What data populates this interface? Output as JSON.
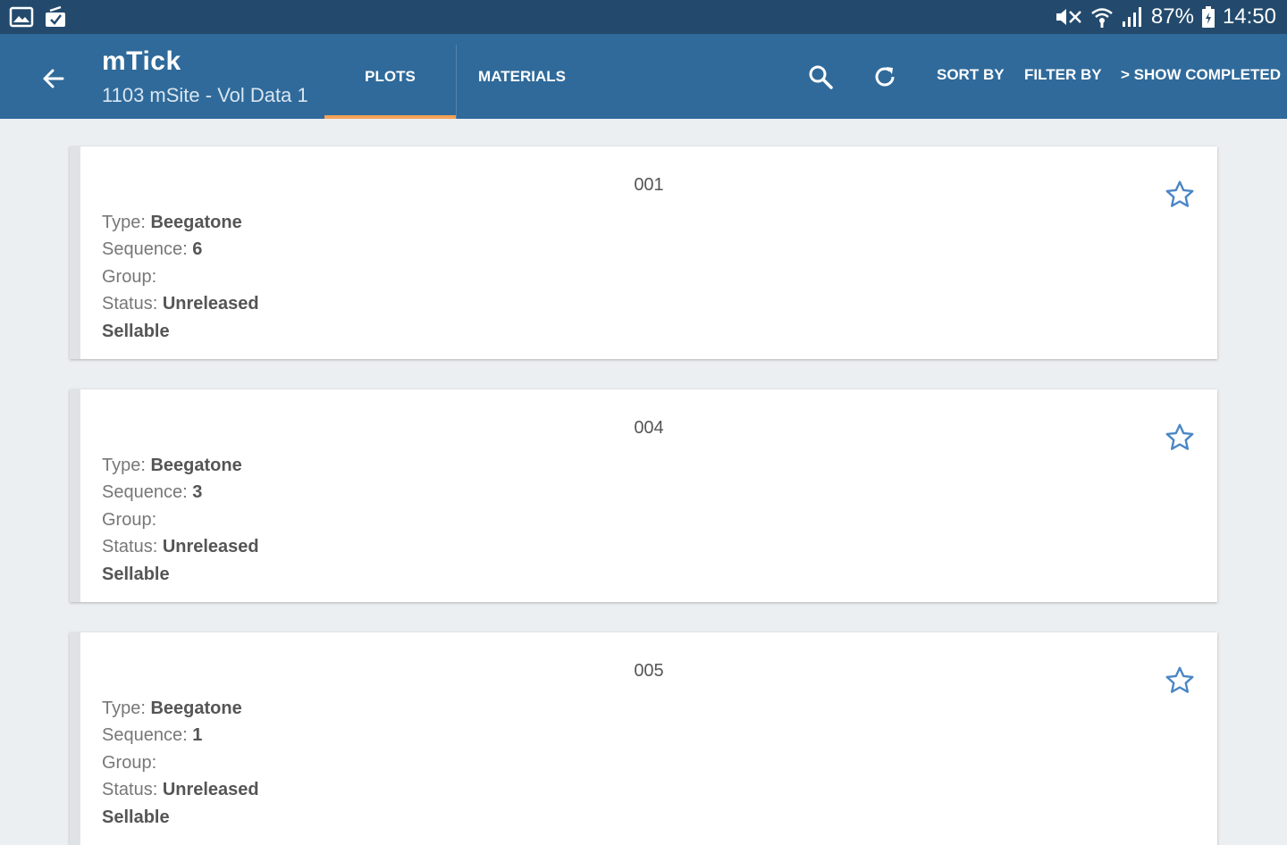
{
  "status_bar": {
    "battery": "87%",
    "time": "14:50",
    "icons": [
      "gallery-icon",
      "download-icon",
      "mute-icon",
      "wifi-icon",
      "signal-icon",
      "battery-icon"
    ]
  },
  "app_bar": {
    "title": "mTick",
    "subtitle": "1103 mSite - Vol Data 1",
    "tabs": [
      {
        "label": "PLOTS",
        "active": true
      },
      {
        "label": "MATERIALS",
        "active": false
      }
    ],
    "actions": {
      "sort": "SORT BY",
      "filter": "FILTER BY",
      "show_completed": "> SHOW COMPLETED"
    },
    "colors": {
      "status_bar": "#234a6c",
      "app_bar": "#2f6a9a",
      "tab_indicator": "#f4a259",
      "star": "#4a86c5"
    }
  },
  "cards": [
    {
      "id": "001",
      "type_label": "Type: ",
      "type": "Beegatone",
      "sequence_label": "Sequence: ",
      "sequence": "6",
      "group_label": "Group:",
      "group": "",
      "status_label": "Status: ",
      "status": "Unreleased",
      "sellable": "Sellable"
    },
    {
      "id": "004",
      "type_label": "Type: ",
      "type": "Beegatone",
      "sequence_label": "Sequence: ",
      "sequence": "3",
      "group_label": "Group:",
      "group": "",
      "status_label": "Status: ",
      "status": "Unreleased",
      "sellable": "Sellable"
    },
    {
      "id": "005",
      "type_label": "Type: ",
      "type": "Beegatone",
      "sequence_label": "Sequence: ",
      "sequence": "1",
      "group_label": "Group:",
      "group": "",
      "status_label": "Status: ",
      "status": "Unreleased",
      "sellable": "Sellable"
    }
  ]
}
